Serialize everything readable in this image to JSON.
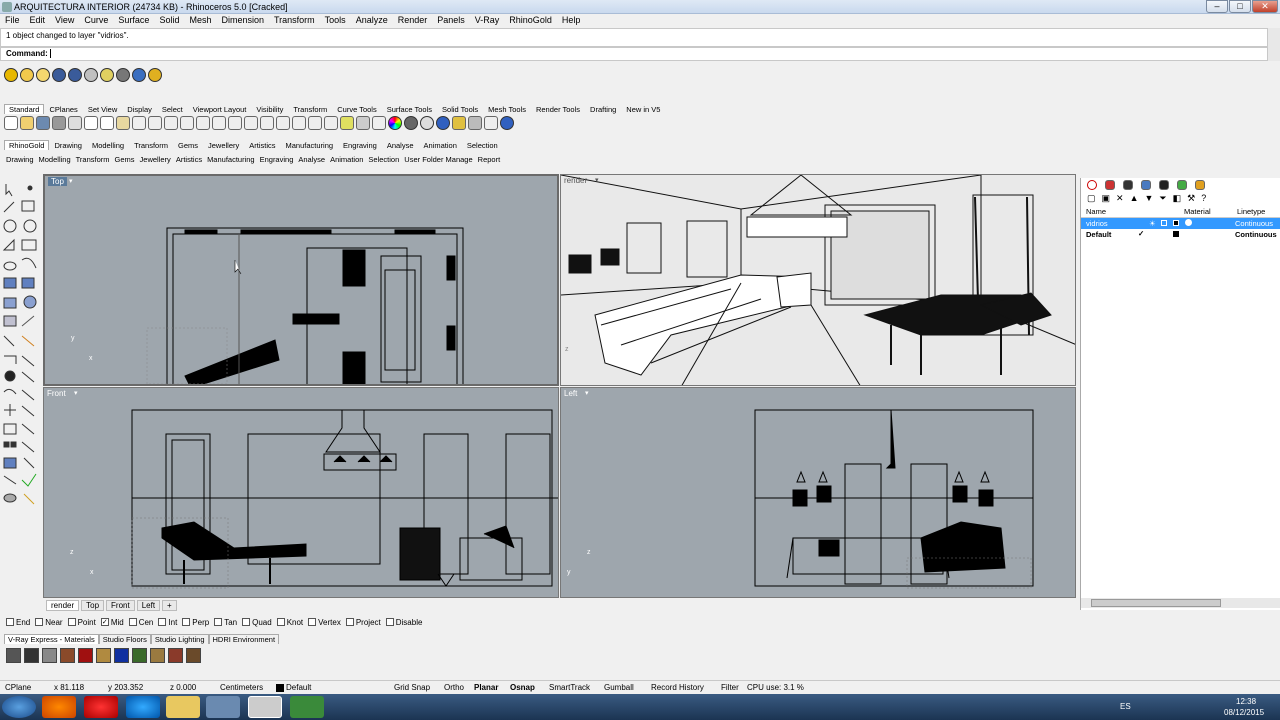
{
  "window": {
    "title": "ARQUITECTURA INTERIOR (24734 KB) - Rhinoceros 5.0 [Cracked]",
    "min": "–",
    "max": "□",
    "close": "✕"
  },
  "menu": [
    "File",
    "Edit",
    "View",
    "Curve",
    "Surface",
    "Solid",
    "Mesh",
    "Dimension",
    "Transform",
    "Tools",
    "Analyze",
    "Render",
    "Panels",
    "V-Ray",
    "RhinoGold",
    "Help"
  ],
  "command": {
    "history": "1 object changed to layer \"vidrios\".",
    "prompt": "Command:"
  },
  "toolbar_tabs_1": [
    "Standard",
    "CPlanes",
    "Set View",
    "Display",
    "Select",
    "Viewport Layout",
    "Visibility",
    "Transform",
    "Curve Tools",
    "Surface Tools",
    "Solid Tools",
    "Mesh Tools",
    "Render Tools",
    "Drafting",
    "New in V5"
  ],
  "toolbar_tabs_2": [
    "RhinoGold",
    "Drawing",
    "Modelling",
    "Transform",
    "Gems",
    "Jewellery",
    "Artistics",
    "Manufacturing",
    "Engraving",
    "Analyse",
    "Animation",
    "Selection"
  ],
  "toolbar_tabs_3": [
    "Drawing",
    "Modelling",
    "Transform",
    "Gems",
    "Jewellery",
    "Artistics",
    "Manufacturing",
    "Engraving",
    "Analyse",
    "Animation",
    "Selection",
    "User Folder Manage",
    "Report"
  ],
  "viewports": {
    "top": "Top",
    "render": "render",
    "front": "Front",
    "left": "Left"
  },
  "viewport_tabs": [
    "render",
    "Top",
    "Front",
    "Left",
    "+"
  ],
  "layers": {
    "headers": {
      "name": "Name",
      "material": "Material",
      "linetype": "Linetype"
    },
    "rows": [
      {
        "name": "vidrios",
        "linetype": "Continuous",
        "selected": true
      },
      {
        "name": "Default",
        "check": "✓",
        "linetype": "Continuous",
        "selected": false
      }
    ]
  },
  "osnaps": [
    {
      "label": "End",
      "checked": false
    },
    {
      "label": "Near",
      "checked": false
    },
    {
      "label": "Point",
      "checked": false
    },
    {
      "label": "Mid",
      "checked": true
    },
    {
      "label": "Cen",
      "checked": false
    },
    {
      "label": "Int",
      "checked": false
    },
    {
      "label": "Perp",
      "checked": false
    },
    {
      "label": "Tan",
      "checked": false
    },
    {
      "label": "Quad",
      "checked": false
    },
    {
      "label": "Knot",
      "checked": false
    },
    {
      "label": "Vertex",
      "checked": false
    },
    {
      "label": "Project",
      "checked": false
    },
    {
      "label": "Disable",
      "checked": false
    }
  ],
  "vray_tabs": [
    "V-Ray Express - Materials",
    "Studio Floors",
    "Studio Lighting",
    "HDRI Environment"
  ],
  "status": {
    "cplane": "CPlane",
    "x": "x 81.118",
    "y": "y 203.352",
    "z": "z 0.000",
    "units": "Centimeters",
    "layer": "Default",
    "grid_snap": "Grid Snap",
    "ortho": "Ortho",
    "planar": "Planar",
    "osnap": "Osnap",
    "smarttrack": "SmartTrack",
    "gumball": "Gumball",
    "record_history": "Record History",
    "filter": "Filter",
    "cpu": "CPU use: 3.1 %"
  },
  "taskbar": {
    "lang": "ES",
    "time": "12:38",
    "date": "08/12/2015"
  }
}
